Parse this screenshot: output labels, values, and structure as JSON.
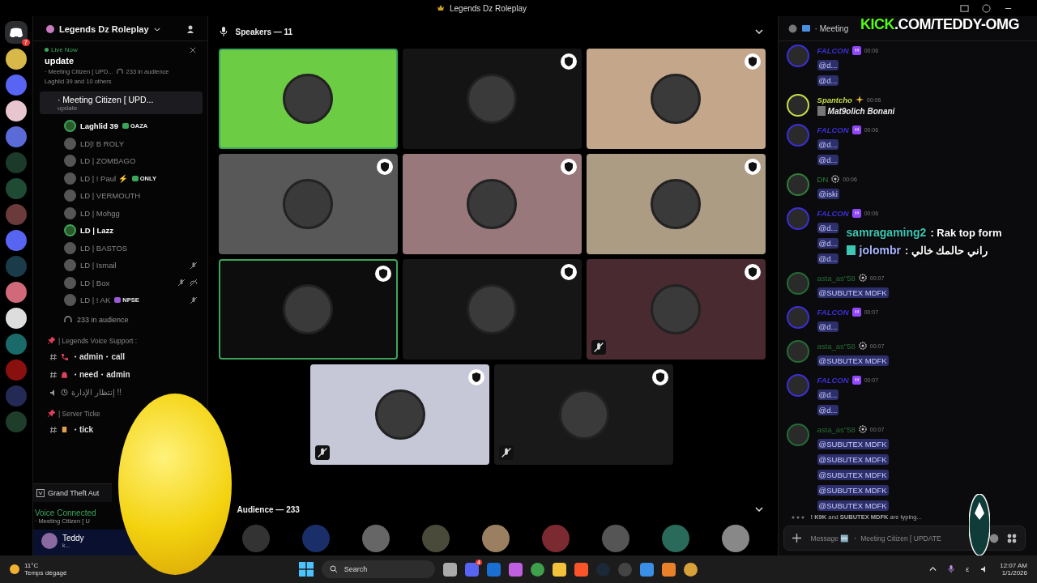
{
  "title_bar": {
    "title": "Legends Dz Roleplay"
  },
  "overlay": {
    "brand": "KICK",
    "url": ".COM/TEDDY-OMG",
    "chat": [
      {
        "user": "samragaming2",
        "text": ": Rak top form",
        "kind": "plain"
      },
      {
        "user": "jolombr",
        "text": ": راني حالمك خالي",
        "kind": "icon"
      }
    ]
  },
  "server_rail": {
    "mention_count": "7"
  },
  "sidebar": {
    "server_name": "Legends Dz Roleplay",
    "live": {
      "label": "Live Now",
      "title": "update",
      "channel": "· Meeting Citizen [ UPD...",
      "audience": "233 in audience",
      "speakers": "Laghlid 39 and 10 others"
    },
    "voice_channel": {
      "name": "· Meeting Citizen [ UPD...",
      "topic": "update",
      "selected": true
    },
    "members": [
      {
        "name": "Laghlid 39",
        "speaking": true,
        "muted": false,
        "deafened": false,
        "badge": {
          "text": "GAZA",
          "color": "#3ba55c"
        }
      },
      {
        "name": "LD|! B ROLY",
        "speaking": false,
        "muted": false,
        "deafened": false
      },
      {
        "name": "LD | ZOMBAGO",
        "speaking": false,
        "muted": false,
        "deafened": false
      },
      {
        "name": "LD | ! Paul ⚡",
        "speaking": false,
        "muted": false,
        "deafened": false,
        "badge": {
          "text": "ONLY",
          "color": "#3ba55c"
        }
      },
      {
        "name": "LD | VERMOUTH",
        "speaking": false,
        "muted": false,
        "deafened": false
      },
      {
        "name": "LD | Mohgg",
        "speaking": false,
        "muted": false,
        "deafened": false
      },
      {
        "name": "LD | Lazz",
        "speaking": true,
        "muted": false,
        "deafened": false
      },
      {
        "name": "LD | BASTOS",
        "speaking": false,
        "muted": false,
        "deafened": false
      },
      {
        "name": "LD | Ismail",
        "speaking": false,
        "muted": true,
        "deafened": false
      },
      {
        "name": "LD | Box",
        "speaking": false,
        "muted": true,
        "deafened": true
      },
      {
        "name": "LD | ! AK",
        "speaking": false,
        "muted": true,
        "deafened": false,
        "badge": {
          "text": "NPSE",
          "color": "#9b59d6"
        }
      }
    ],
    "audience": "233 in audience",
    "categories": [
      {
        "name": "| Legends Voice Support :",
        "channels": [
          {
            "kind": "text",
            "name": "・admin・call"
          },
          {
            "kind": "text",
            "name": "・need・admin"
          },
          {
            "kind": "voice",
            "name": "إنتظار الإدارة !!"
          }
        ]
      },
      {
        "name": "| Server Ticke",
        "channels": [
          {
            "kind": "text",
            "name": "・tick"
          }
        ]
      }
    ],
    "activity": "Grand Theft Aut",
    "voice": {
      "status": "Voice Connected",
      "channel": "· Meeting Citizen [ U"
    },
    "user": {
      "name": "Teddy",
      "status": "k..."
    }
  },
  "stage": {
    "speakers_label": "Speakers — 11",
    "audience_label": "Audience — 233",
    "tiles": [
      {
        "color": "#6ccd45",
        "speaking": true,
        "moderator": false,
        "muted": false
      },
      {
        "color": "#141414",
        "speaking": false,
        "moderator": true,
        "muted": false
      },
      {
        "color": "#c4a68b",
        "speaking": false,
        "moderator": true,
        "muted": false
      },
      {
        "color": "#585858",
        "speaking": false,
        "moderator": true,
        "muted": false
      },
      {
        "color": "#98787a",
        "speaking": false,
        "moderator": true,
        "muted": false
      },
      {
        "color": "#ad9c84",
        "speaking": false,
        "moderator": true,
        "muted": false
      },
      {
        "color": "#0d0d0d",
        "speaking": true,
        "moderator": true,
        "muted": false
      },
      {
        "color": "#161616",
        "speaking": false,
        "moderator": true,
        "muted": false
      },
      {
        "color": "#4a2a31",
        "speaking": false,
        "moderator": true,
        "muted": true
      },
      {
        "color": "#c6c8d8",
        "speaking": false,
        "moderator": true,
        "muted": true
      },
      {
        "color": "#191919",
        "speaking": false,
        "moderator": true,
        "muted": true
      }
    ]
  },
  "chat": {
    "header": "· Meeting",
    "messages": [
      {
        "author": "FALCON",
        "color": "#3d2ed6",
        "italic": true,
        "kind": "twitch",
        "time": "00:06",
        "lines": [
          {
            "kind": "mention",
            "text": "@d..."
          },
          {
            "kind": "mention",
            "text": "@d..."
          }
        ]
      },
      {
        "author": "Spantcho",
        "color": "#c6df46",
        "italic": true,
        "kind": "sparkle",
        "time": "00:06",
        "lines": [
          {
            "kind": "text",
            "text": "Mat9olich Bonani"
          }
        ]
      },
      {
        "author": "FALCON",
        "color": "#3d2ed6",
        "italic": true,
        "kind": "twitch",
        "time": "00:06",
        "lines": [
          {
            "kind": "mention",
            "text": "@d..."
          },
          {
            "kind": "mention",
            "text": "@d..."
          }
        ]
      },
      {
        "author": "DN",
        "color": "#2f7d3a",
        "italic": false,
        "kind": "gear",
        "time": "00:06",
        "lines": [
          {
            "kind": "mention",
            "text": "@iski"
          }
        ]
      },
      {
        "author": "FALCON",
        "color": "#3d2ed6",
        "italic": true,
        "kind": "twitch",
        "time": "00:06",
        "lines": [
          {
            "kind": "mention",
            "text": "@d..."
          },
          {
            "kind": "mention",
            "text": "@d..."
          },
          {
            "kind": "mention",
            "text": "@d..."
          }
        ]
      },
      {
        "author": "asta_as\"58",
        "color": "#236b33",
        "italic": false,
        "kind": "gear",
        "time": "00:07",
        "lines": [
          {
            "kind": "mention",
            "text": "@SUBUTEX MDFK"
          }
        ]
      },
      {
        "author": "FALCON",
        "color": "#3d2ed6",
        "italic": true,
        "kind": "twitch",
        "time": "00:07",
        "lines": [
          {
            "kind": "mention",
            "text": "@d..."
          }
        ]
      },
      {
        "author": "asta_as\"58",
        "color": "#236b33",
        "italic": false,
        "kind": "gear",
        "time": "00:07",
        "lines": [
          {
            "kind": "mention",
            "text": "@SUBUTEX MDFK"
          }
        ]
      },
      {
        "author": "FALCON",
        "color": "#3d2ed6",
        "italic": true,
        "kind": "twitch",
        "time": "00:07",
        "lines": [
          {
            "kind": "mention",
            "text": "@d..."
          },
          {
            "kind": "mention",
            "text": "@d..."
          }
        ]
      },
      {
        "author": "asta_as\"58",
        "color": "#236b33",
        "italic": false,
        "kind": "gear",
        "time": "00:07",
        "lines": [
          {
            "kind": "mention",
            "text": "@SUBUTEX MDFK"
          },
          {
            "kind": "mention",
            "text": "@SUBUTEX MDFK"
          },
          {
            "kind": "mention",
            "text": "@SUBUTEX MDFK"
          },
          {
            "kind": "mention",
            "text": "@SUBUTEX MDFK"
          },
          {
            "kind": "mention",
            "text": "@SUBUTEX MDFK"
          }
        ]
      }
    ],
    "typing": "**! K9K** and **SUBUTEX MDFK** are typing...",
    "placeholder": "Message 🆕 ・ Meeting Citizen [ UPDATE"
  },
  "taskbar": {
    "temperature": "11°C",
    "weather": "Temps dégagé",
    "search": "Search",
    "discord_badge": "4",
    "language": "ε",
    "time": "12:07 AM",
    "date": "1/1/2026"
  }
}
